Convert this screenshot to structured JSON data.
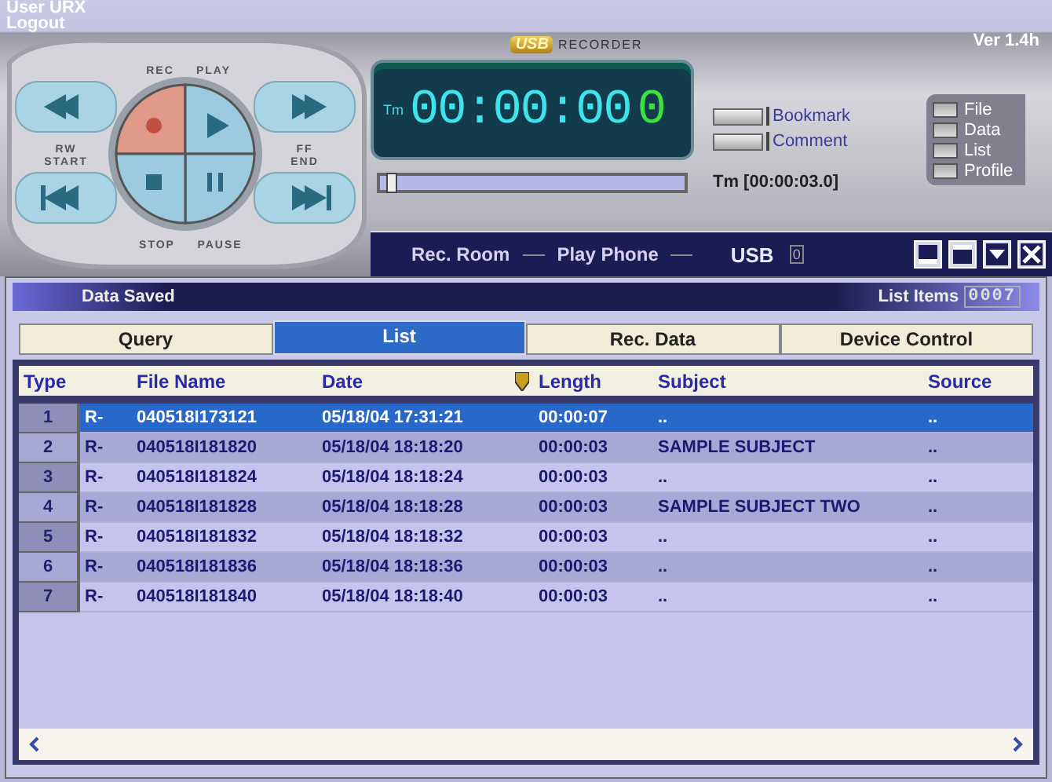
{
  "header": {
    "user": "User URX",
    "logout": "Logout",
    "logo_mark": "USB",
    "logo_text": "RECORDER",
    "version": "Ver 1.4h"
  },
  "transport": {
    "rec": "REC",
    "play": "PLAY",
    "rw": "RW",
    "start": "START",
    "ff": "FF",
    "end": "END",
    "stop": "STOP",
    "pause": "PAUSE"
  },
  "display": {
    "label": "Tm",
    "time": "00:00:00",
    "time_last": "0",
    "progress": {
      "level": 0.02
    },
    "elapsed": "Tm [00:00:03.0]"
  },
  "markers": [
    {
      "label": "Bookmark"
    },
    {
      "label": "Comment"
    }
  ],
  "side_menu": [
    {
      "label": "File"
    },
    {
      "label": "Data"
    },
    {
      "label": "List"
    },
    {
      "label": "Profile"
    }
  ],
  "bar": {
    "items": [
      "Rec. Room",
      "Play Phone"
    ],
    "usb_label": "USB",
    "usb_count": "0"
  },
  "panel": {
    "title": "Data Saved",
    "count_label": "List Items",
    "count": "0007"
  },
  "tabs": [
    {
      "label": "Query",
      "selected": false
    },
    {
      "label": "List",
      "selected": true
    },
    {
      "label": "Rec. Data",
      "selected": false
    },
    {
      "label": "Device Control",
      "selected": false
    }
  ],
  "table": {
    "columns": [
      "Type",
      "File Name",
      "Date",
      "Length",
      "Subject",
      "Source"
    ],
    "rows": [
      {
        "number": "1",
        "type": "R-",
        "file_name": "040518I173121",
        "date": "05/18/04 17:31:21",
        "length": "00:00:07",
        "subject": "..",
        "source": "..",
        "selected": true
      },
      {
        "number": "2",
        "type": "R-",
        "file_name": "040518I181820",
        "date": "05/18/04 18:18:20",
        "length": "00:00:03",
        "subject": "SAMPLE SUBJECT",
        "source": "..",
        "selected": false
      },
      {
        "number": "3",
        "type": "R-",
        "file_name": "040518I181824",
        "date": "05/18/04 18:18:24",
        "length": "00:00:03",
        "subject": "..",
        "source": "..",
        "selected": false
      },
      {
        "number": "4",
        "type": "R-",
        "file_name": "040518I181828",
        "date": "05/18/04 18:18:28",
        "length": "00:00:03",
        "subject": "SAMPLE SUBJECT TWO",
        "source": "..",
        "selected": false
      },
      {
        "number": "5",
        "type": "R-",
        "file_name": "040518I181832",
        "date": "05/18/04 18:18:32",
        "length": "00:00:03",
        "subject": "..",
        "source": "..",
        "selected": false
      },
      {
        "number": "6",
        "type": "R-",
        "file_name": "040518I181836",
        "date": "05/18/04 18:18:36",
        "length": "00:00:03",
        "subject": "..",
        "source": "..",
        "selected": false
      },
      {
        "number": "7",
        "type": "R-",
        "file_name": "040518I181840",
        "date": "05/18/04 18:18:40",
        "length": "00:00:03",
        "subject": "..",
        "source": "..",
        "selected": false
      }
    ]
  }
}
